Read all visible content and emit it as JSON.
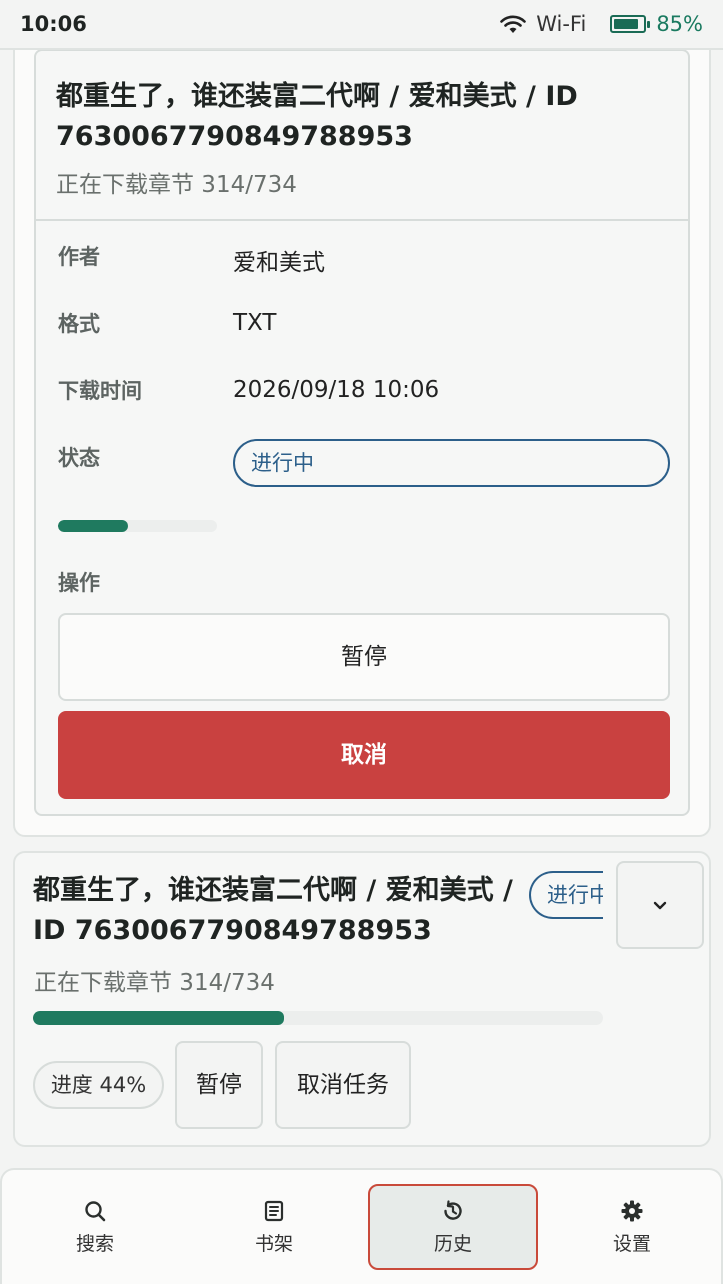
{
  "status_bar": {
    "time": "10:06",
    "wifi_label": "Wi-Fi",
    "battery_pct": "85%",
    "battery_level": 0.85
  },
  "expanded_task": {
    "title": "都重生了，谁还装富二代啊 / 爱和美式 / ID 7630067790849788953",
    "subtitle": "正在下载章节 314/734",
    "author_label": "作者",
    "author_value": "爱和美式",
    "format_label": "格式",
    "format_value": "TXT",
    "time_label": "下载时间",
    "time_value": "2026/09/18 10:06",
    "status_label": "状态",
    "status_value": "进行中",
    "progress": 0.44,
    "actions_label": "操作",
    "pause_label": "暂停",
    "cancel_label": "取消"
  },
  "task_card": {
    "title": "都重生了，谁还装富二代啊 / 爱和美式 / ID 7630067790849788953",
    "status_value": "进行中",
    "subtitle": "正在下载章节 314/734",
    "progress": 0.44,
    "progress_label": "进度 44%",
    "pause_label": "暂停",
    "cancel_label": "取消任务"
  },
  "bottom_nav": {
    "items": [
      {
        "label": "搜索",
        "icon": "search-icon"
      },
      {
        "label": "书架",
        "icon": "bookshelf-icon"
      },
      {
        "label": "历史",
        "icon": "history-icon"
      },
      {
        "label": "设置",
        "icon": "gear-icon"
      }
    ],
    "active_index": 2
  },
  "colors": {
    "accent_green": "#1f7a5f",
    "status_blue": "#2c5f8a",
    "danger_red": "#c94140"
  }
}
